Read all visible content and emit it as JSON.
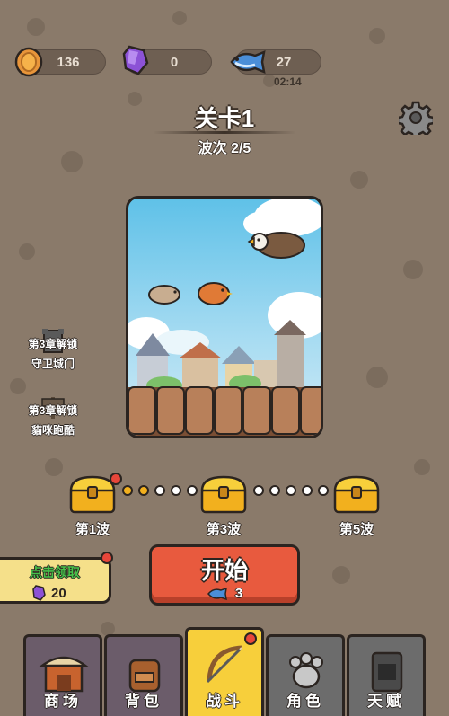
{
  "resources": {
    "coins": "136",
    "gems": "0",
    "fish": "27",
    "fish_timer": "02:14"
  },
  "level": {
    "title": "关卡1",
    "wave": "波次 2/5"
  },
  "locked_modes": [
    {
      "label_1": "第3章解锁",
      "label_2": "守卫城门"
    },
    {
      "label_1": "第3章解锁",
      "label_2": "貓咪跑酷"
    }
  ],
  "waves": {
    "labels": [
      "第1波",
      "第3波",
      "第5波"
    ],
    "progress_current": 2,
    "progress_total": 5
  },
  "start_button": {
    "label": "开始",
    "cost": "3"
  },
  "claim": {
    "label": "点击领取",
    "amount": "20"
  },
  "nav": {
    "tabs": [
      {
        "label": "商场",
        "active": false
      },
      {
        "label": "背包",
        "active": false
      },
      {
        "label": "战斗",
        "active": true
      },
      {
        "label": "角色",
        "active": false
      },
      {
        "label": "天赋",
        "active": false
      }
    ]
  },
  "colors": {
    "background": "#8a7a6a",
    "start": "#e85a3e",
    "active_tab": "#f7cf3b",
    "claim_bg": "#f5e08a",
    "claim_text": "#46c24a",
    "dot_on": "#f2b01e"
  }
}
